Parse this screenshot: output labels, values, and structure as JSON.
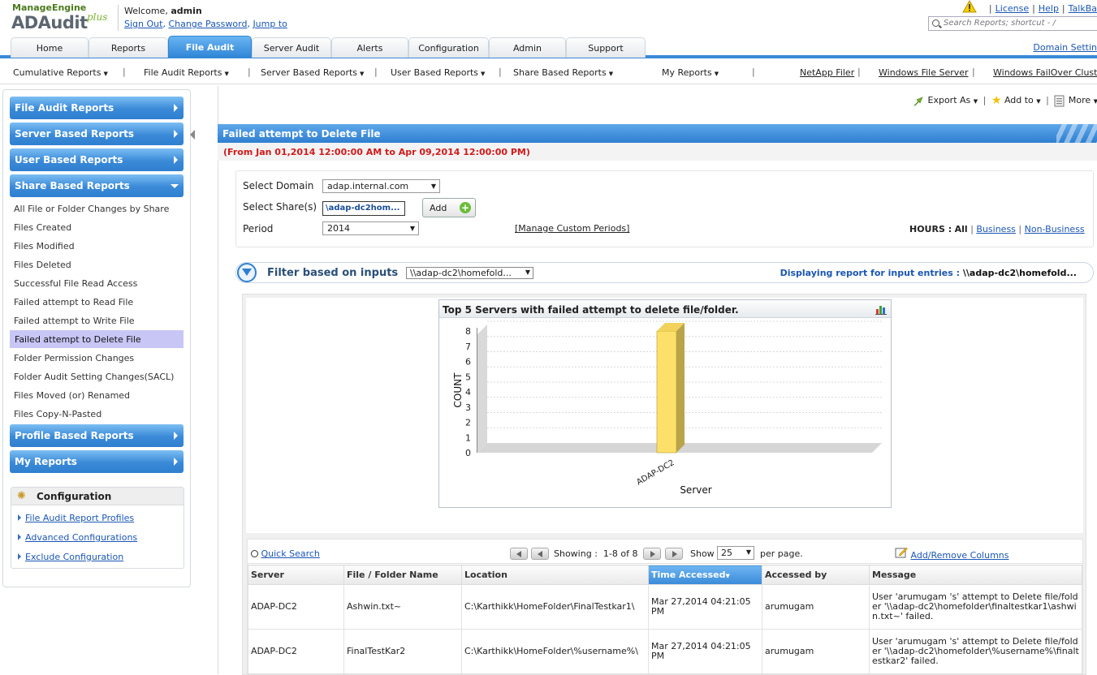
{
  "header": {
    "logo_top": "ManageEngine",
    "logo_main": "ADAudit",
    "logo_plus": "plus",
    "welcome_prefix": "Welcome,",
    "welcome_user": "admin",
    "user_links": [
      "Sign Out",
      "Change Password",
      "Jump to"
    ],
    "top_links": [
      "License",
      "Help",
      "TalkBa"
    ],
    "search_placeholder": "Search Reports; shortcut - /"
  },
  "tabs": [
    {
      "label": "Home",
      "active": false
    },
    {
      "label": "Reports",
      "active": false
    },
    {
      "label": "File Audit",
      "active": true
    },
    {
      "label": "Server Audit",
      "active": false
    },
    {
      "label": "Alerts",
      "active": false
    },
    {
      "label": "Configuration",
      "active": false
    },
    {
      "label": "Admin",
      "active": false
    },
    {
      "label": "Support",
      "active": false
    }
  ],
  "domain_settings": "Domain Settin",
  "subnav": {
    "menus": [
      "Cumulative Reports",
      "File Audit Reports",
      "Server Based Reports",
      "User Based Reports",
      "Share Based Reports",
      "My Reports"
    ],
    "right_links": [
      "NetApp Filer",
      "Windows File Server",
      "Windows FailOver Clust"
    ]
  },
  "sidebar": {
    "sections": [
      "File Audit Reports",
      "Server Based Reports",
      "User Based Reports",
      "Share Based Reports",
      "Profile Based Reports",
      "My Reports"
    ],
    "share_items": [
      "All File or Folder Changes by Share",
      "Files Created",
      "Files Modified",
      "Files Deleted",
      "Successful File Read Access",
      "Failed attempt to Read File",
      "Failed attempt to Write File",
      "Failed attempt to Delete File",
      "Folder Permission Changes",
      "Folder Audit Setting Changes(SACL)",
      "Files Moved (or) Renamed",
      "Files Copy-N-Pasted"
    ],
    "selected_index": 7,
    "config_title": "Configuration",
    "config_links": [
      "File Audit Report Profiles",
      "Advanced Configurations",
      "Exclude Configuration"
    ]
  },
  "actions": {
    "export": "Export As",
    "add_to": "Add to",
    "more": "More"
  },
  "report": {
    "title": "Failed attempt to Delete File",
    "period_text": "(From Jan 01,2014 12:00:00 AM to Apr 09,2014 12:00:00 PM)"
  },
  "form": {
    "domain_label": "Select Domain",
    "domain_value": "adap.internal.com",
    "share_label": "Select Share(s)",
    "share_value": "\\adap-dc2hom...",
    "add_label": "Add",
    "period_label": "Period",
    "period_value": "2014",
    "manage_link": "[Manage Custom Periods]",
    "hours_label": "HOURS :",
    "hours_all": "All",
    "hours_business": "Business",
    "hours_nonbusiness": "Non-Business"
  },
  "filter": {
    "label": "Filter based on inputs",
    "select_value": "\\\\adap-dc2\\homefold...",
    "display_prefix": "Displaying report for input entries :",
    "display_value": "\\\\adap-dc2\\homefold..."
  },
  "chart_data": {
    "type": "bar",
    "title": "Top 5 Servers with failed attempt to delete file/folder.",
    "categories": [
      "ADAP-DC2"
    ],
    "values": [
      8
    ],
    "xlabel": "Server",
    "ylabel": "COUNT",
    "ylim": [
      0,
      8
    ],
    "yticks": [
      0,
      1,
      2,
      3,
      4,
      5,
      6,
      7,
      8
    ],
    "bar_color": "#fde06a",
    "grid": true
  },
  "table": {
    "quick_search": "Quick Search",
    "showing_label": "Showing :",
    "showing_value": "1-8 of 8",
    "show_label": "Show",
    "per_page_value": "25",
    "per_page_suffix": "per page.",
    "add_remove": "Add/Remove Columns",
    "columns": [
      "Server",
      "File / Folder Name",
      "Location",
      "Time Accessed",
      "Accessed by",
      "Message"
    ],
    "sorted_column": 3,
    "rows": [
      [
        "ADAP-DC2",
        "Ashwin.txt~",
        "C:\\Karthikk\\HomeFolder\\FinalTestkar1\\",
        "Mar 27,2014 04:21:05 PM",
        "arumugam",
        "User 'arumugam 's' attempt to Delete file/folder '\\\\adap-dc2\\homefolder\\finaltestkar1\\ashwin.txt~' failed."
      ],
      [
        "ADAP-DC2",
        "FinalTestKar2",
        "C:\\Karthikk\\HomeFolder\\%username%\\",
        "Mar 27,2014 04:21:05 PM",
        "arumugam",
        "User 'arumugam 's' attempt to Delete file/folder '\\\\adap-dc2\\homefolder\\%username%\\finaltestkar2' failed."
      ]
    ]
  }
}
